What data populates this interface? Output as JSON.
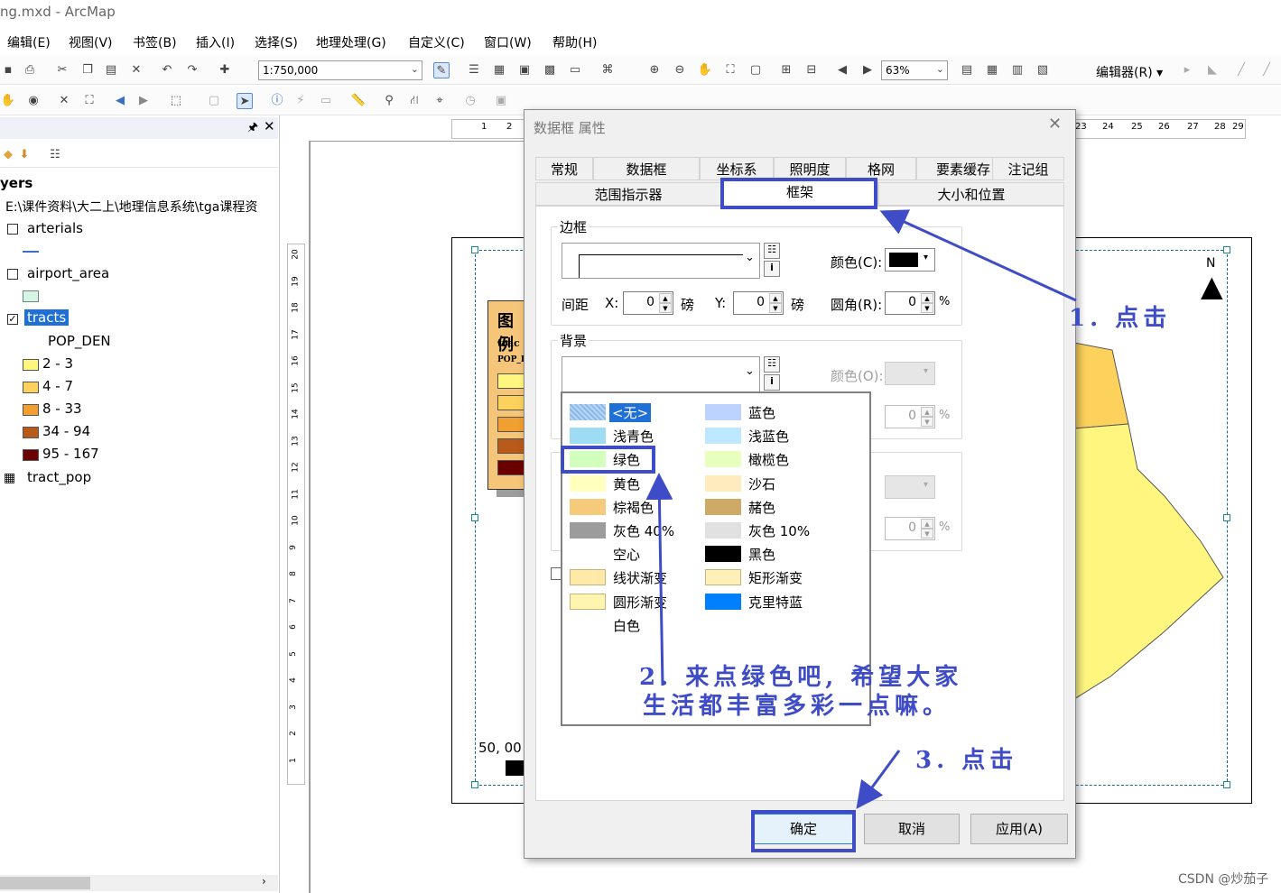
{
  "window": {
    "title": "ng.mxd - ArcMap"
  },
  "menu": [
    "编辑(E)",
    "视图(V)",
    "书签(B)",
    "插入(I)",
    "选择(S)",
    "地理处理(G)",
    "自定义(C)",
    "窗口(W)",
    "帮助(H)"
  ],
  "toolbar": {
    "scale_value": "1:750,000",
    "zoom_value": "63%",
    "editor_label": "编辑器(R) ▾"
  },
  "toc": {
    "header": "yers",
    "path": "E:\\课件资料\\大二上\\地理信息系统\\tga课程资",
    "layers": [
      {
        "name": "arterials",
        "checked": false
      },
      {
        "name": "airport_area",
        "checked": false
      },
      {
        "name": "tracts",
        "checked": true
      }
    ],
    "field_name": "POP_DEN",
    "classes": [
      {
        "label": "2 - 3",
        "color": "#fff680"
      },
      {
        "label": "4 - 7",
        "color": "#fcd25c"
      },
      {
        "label": "8 - 33",
        "color": "#f0a030"
      },
      {
        "label": "34 - 94",
        "color": "#b85a1a"
      },
      {
        "label": "95 - 167",
        "color": "#6b0000"
      }
    ],
    "table": "tract_pop"
  },
  "layout": {
    "legend_title": "图例",
    "legend_layer": "trac",
    "legend_field": "POP_D",
    "scale_text": "50, 00",
    "north_label": "N",
    "ruler_h_labels": [
      "1",
      "2",
      "23",
      "24",
      "25",
      "26",
      "27",
      "28",
      "29"
    ],
    "ruler_v_labels": [
      "20",
      "19",
      "18",
      "17",
      "16",
      "15",
      "14",
      "13",
      "12",
      "11",
      "10",
      "9",
      "8",
      "7",
      "6",
      "5",
      "4",
      "3",
      "2",
      "1"
    ]
  },
  "dialog": {
    "title": "数据框 属性",
    "tabs_row1": [
      "常规",
      "数据框",
      "坐标系",
      "照明度",
      "格网",
      "要素缓存",
      "注记组"
    ],
    "tabs_row2": [
      "范围指示器",
      "框架",
      "大小和位置"
    ],
    "border_group": "边框",
    "color_label": "颜色(C):",
    "gap_label": "间距",
    "x_label": "X:",
    "y_label": "Y:",
    "unit_pt": "磅",
    "radius_label": "圆角(R):",
    "gap_x": "0",
    "gap_y": "0",
    "radius": "0",
    "percent": "%",
    "bg_group": "背景",
    "bg_color_label": "颜色(O):",
    "bg_radius": "0",
    "shadow_radius": "0",
    "ok": "确定",
    "cancel": "取消",
    "apply": "应用(A)"
  },
  "palette": [
    {
      "label": "<无>",
      "color": "#9fc8ee",
      "col": 0,
      "row": 0,
      "selected": true
    },
    {
      "label": "蓝色",
      "color": "#bed2ff",
      "col": 1,
      "row": 0
    },
    {
      "label": "浅青色",
      "color": "#9edcf4",
      "col": 0,
      "row": 1
    },
    {
      "label": "浅蓝色",
      "color": "#bee8ff",
      "col": 1,
      "row": 1
    },
    {
      "label": "绿色",
      "color": "#d3ffbe",
      "col": 0,
      "row": 2
    },
    {
      "label": "橄榄色",
      "color": "#e9ffbe",
      "col": 1,
      "row": 2
    },
    {
      "label": "黄色",
      "color": "#ffffbe",
      "col": 0,
      "row": 3
    },
    {
      "label": "沙石",
      "color": "#ffebbe",
      "col": 1,
      "row": 3
    },
    {
      "label": "棕褐色",
      "color": "#f5ca7a",
      "col": 0,
      "row": 4
    },
    {
      "label": "赭色",
      "color": "#cdaa66",
      "col": 1,
      "row": 4
    },
    {
      "label": "灰色 40%",
      "color": "#9c9c9c",
      "col": 0,
      "row": 5
    },
    {
      "label": "灰色 10%",
      "color": "#e1e1e1",
      "col": 1,
      "row": 5
    },
    {
      "label": "空心",
      "color": "#ffffff",
      "col": 0,
      "row": 6
    },
    {
      "label": "黑色",
      "color": "#000000",
      "col": 1,
      "row": 6
    },
    {
      "label": "线状渐变",
      "color": "#ffe9a8",
      "col": 0,
      "row": 7
    },
    {
      "label": "矩形渐变",
      "color": "#fff0b8",
      "col": 1,
      "row": 7
    },
    {
      "label": "圆形渐变",
      "color": "#fff4b0",
      "col": 0,
      "row": 8
    },
    {
      "label": "克里特蓝",
      "color": "#0080ff",
      "col": 1,
      "row": 8
    },
    {
      "label": "白色",
      "color": "#ffffff",
      "col": 0,
      "row": 9
    }
  ],
  "annotations": {
    "step1": "1. 点击",
    "step2_line1": "2. 来点绿色吧, 希望大家",
    "step2_line2": "生活都丰富多彩一点嘛。",
    "step3": "3. 点击",
    "accent": "#3f4cc7"
  },
  "watermark": "CSDN @炒茄子"
}
